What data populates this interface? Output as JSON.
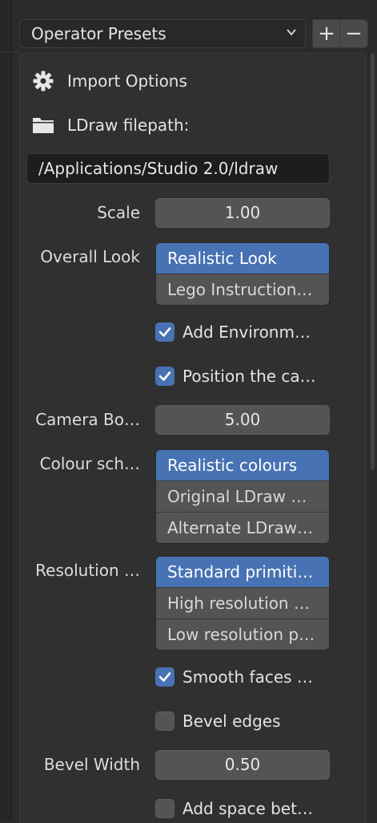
{
  "presets": {
    "label": "Operator Presets",
    "add_label": "+",
    "remove_label": "−"
  },
  "panel": {
    "import_options": "Import Options",
    "filepath_label": "LDraw filepath:",
    "filepath_value": "/Applications/Studio 2.0/ldraw"
  },
  "scale": {
    "label": "Scale",
    "value": "1.00"
  },
  "overall_look": {
    "label": "Overall Look",
    "options": [
      "Realistic Look",
      "Lego Instruction…"
    ],
    "selected": 0
  },
  "add_environment": {
    "label": "Add Environm…",
    "checked": true
  },
  "position_camera": {
    "label": "Position the ca…",
    "checked": true
  },
  "camera_border": {
    "label": "Camera Bo…",
    "value": "5.00"
  },
  "colour_scheme": {
    "label": "Colour sch…",
    "options": [
      "Realistic colours",
      "Original LDraw …",
      "Alternate LDraw…"
    ],
    "selected": 0
  },
  "resolution": {
    "label": "Resolution …",
    "options": [
      "Standard primiti…",
      "High resolution …",
      "Low resolution p…"
    ],
    "selected": 0
  },
  "smooth_faces": {
    "label": "Smooth faces …",
    "checked": true
  },
  "bevel_edges": {
    "label": "Bevel edges",
    "checked": false
  },
  "bevel_width": {
    "label": "Bevel Width",
    "value": "0.50"
  },
  "add_space": {
    "label": "Add space bet…",
    "checked": false
  },
  "colors": {
    "accent": "#4772b3",
    "panel_bg": "#303030",
    "field_bg": "#545454"
  }
}
